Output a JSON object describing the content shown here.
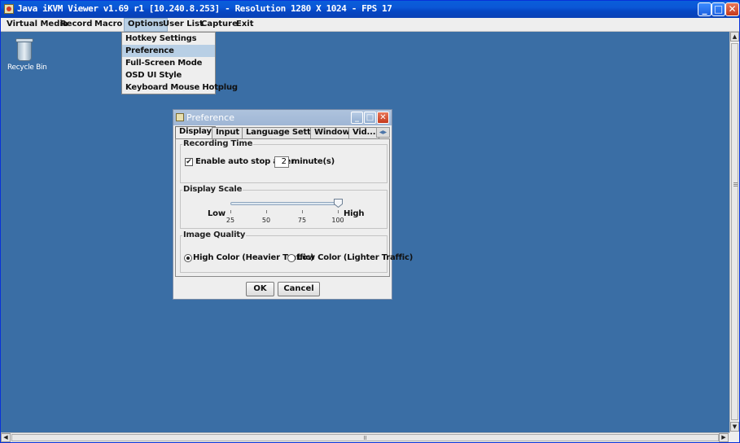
{
  "app": {
    "title": "Java iKVM Viewer v1.69 r1 [10.240.8.253] - Resolution 1280 X 1024 - FPS 17",
    "controls": {
      "minimize": "_",
      "maximize": "□",
      "close": "✕"
    }
  },
  "menubar": {
    "items": [
      "Virtual Media",
      "Record",
      "Macro",
      "Options",
      "User List",
      "Capture",
      "Exit"
    ],
    "active": "Options"
  },
  "options_menu": {
    "items": [
      "Hotkey Settings",
      "Preference",
      "Full-Screen Mode",
      "OSD UI Style",
      "Keyboard Mouse Hotplug"
    ],
    "highlighted": "Preference"
  },
  "desktop": {
    "icons": [
      {
        "label": "Recycle Bin",
        "icon": "recycle-bin-icon"
      }
    ]
  },
  "dialog": {
    "title": "Preference",
    "tabs": [
      "Display",
      "Input",
      "Language Setting",
      "Window",
      "Vid..."
    ],
    "active_tab": "Display",
    "recording_time": {
      "group_label": "Recording Time",
      "checkbox_label": "Enable auto stop after",
      "checked": true,
      "minutes_value": "2",
      "unit_label": "minute(s)"
    },
    "display_scale": {
      "group_label": "Display Scale",
      "low_label": "Low",
      "high_label": "High",
      "ticks": [
        "25",
        "50",
        "75",
        "100"
      ],
      "value": 100,
      "min": 25,
      "max": 100
    },
    "image_quality": {
      "group_label": "Image Quality",
      "options": [
        "High Color (Heavier Traffic)",
        "Low Color (Lighter Traffic)"
      ],
      "selected": "High Color (Heavier Traffic)"
    },
    "buttons": {
      "ok": "OK",
      "cancel": "Cancel"
    }
  },
  "colors": {
    "desktop": "#3a6ea5",
    "titlebar": "#0a5fda",
    "menu_highlight": "#b8cfe5"
  }
}
